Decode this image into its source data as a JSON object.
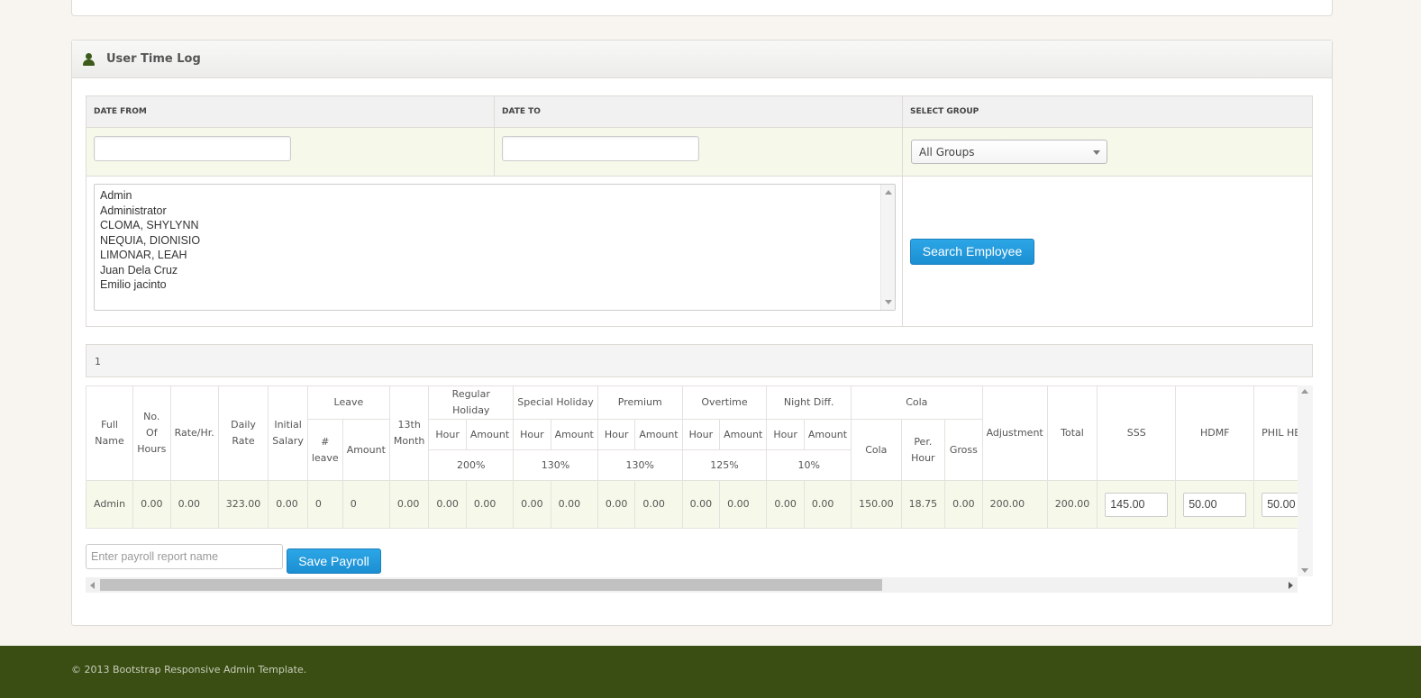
{
  "widget": {
    "title": "User Time Log"
  },
  "filters": {
    "date_from_label": "DATE FROM",
    "date_to_label": "DATE TO",
    "group_label": "SELECT GROUP",
    "date_from_value": "",
    "date_to_value": "",
    "group_selected": "All Groups"
  },
  "employees": [
    "Admin",
    "Administrator",
    "CLOMA, SHYLYNN",
    "NEQUIA, DIONISIO",
    "LIMONAR, LEAH",
    "Juan Dela Cruz",
    "Emilio jacinto"
  ],
  "search_button": "Search Employee",
  "count": "1",
  "table": {
    "h": {
      "full_name": "Full Name",
      "hours": "No. Of Hours",
      "rate": "Rate/Hr.",
      "daily": "Daily Rate",
      "initial": "Initial Salary",
      "leave": "Leave",
      "leave_num": "# leave",
      "amount": "Amount",
      "month13": "13th Month",
      "reg_holiday": "Regular Holiday",
      "spec_holiday": "Special Holiday",
      "premium": "Premium",
      "overtime": "Overtime",
      "night_diff": "Night Diff.",
      "cola": "Cola",
      "hour": "Hour",
      "cola_sub": "Cola",
      "per_hour": "Per. Hour",
      "gross": "Gross",
      "adjustment": "Adjustment",
      "total": "Total",
      "sss": "SSS",
      "hdmf": "HDMF",
      "phil": "PHIL HEALTH",
      "pct_reg": "200%",
      "pct_spec": "130%",
      "pct_prem": "130%",
      "pct_ot": "125%",
      "pct_nd": "10%"
    },
    "row": {
      "full_name": "Admin",
      "hours": "0.00",
      "rate": "0.00",
      "daily": "323.00",
      "initial": "0.00",
      "leave_num": "0",
      "leave_amount": "0",
      "month13": "0.00",
      "reg_hour": "0.00",
      "reg_amount": "0.00",
      "spec_hour": "0.00",
      "spec_amount": "0.00",
      "prem_hour": "0.00",
      "prem_amount": "0.00",
      "ot_hour": "0.00",
      "ot_amount": "0.00",
      "nd_hour": "0.00",
      "nd_amount": "0.00",
      "cola": "150.00",
      "per_hour": "18.75",
      "gross": "0.00",
      "adjustment": "200.00",
      "total": "200.00",
      "sss": "145.00",
      "hdmf": "50.00",
      "phil": "50.00"
    }
  },
  "payroll": {
    "placeholder": "Enter payroll report name",
    "save_button": "Save Payroll"
  },
  "footer": "© 2013 Bootstrap Responsive Admin Template."
}
